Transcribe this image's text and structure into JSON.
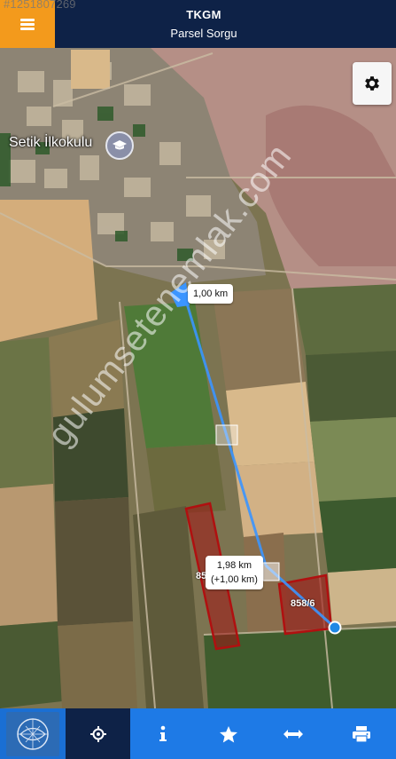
{
  "header": {
    "id_watermark": "#1251807269",
    "title": "TKGM",
    "subtitle": "Parsel Sorgu",
    "menu_icon": "hamburger-icon"
  },
  "map": {
    "place_label": "Setik İlkokulu",
    "place_icon": "school-icon",
    "settings_icon": "gear-icon",
    "measure_labels": {
      "first": "1,00 km",
      "second_line1": "1,98 km",
      "second_line2": "(+1,00 km)"
    },
    "parcels": {
      "a": "85",
      "b": "858/6"
    },
    "watermark_text": "gulumsetenemlak.com",
    "colors": {
      "measure_line": "#3b95ff",
      "parcel_fill": "#a01414",
      "endpoint": "#1e88e5"
    }
  },
  "toolbar": {
    "logo_icon": "tkgm-logo-icon",
    "locate_icon": "crosshair-icon",
    "info_icon": "info-icon",
    "favorite_icon": "star-icon",
    "measure_icon": "measure-arrows-icon",
    "print_icon": "printer-icon"
  }
}
